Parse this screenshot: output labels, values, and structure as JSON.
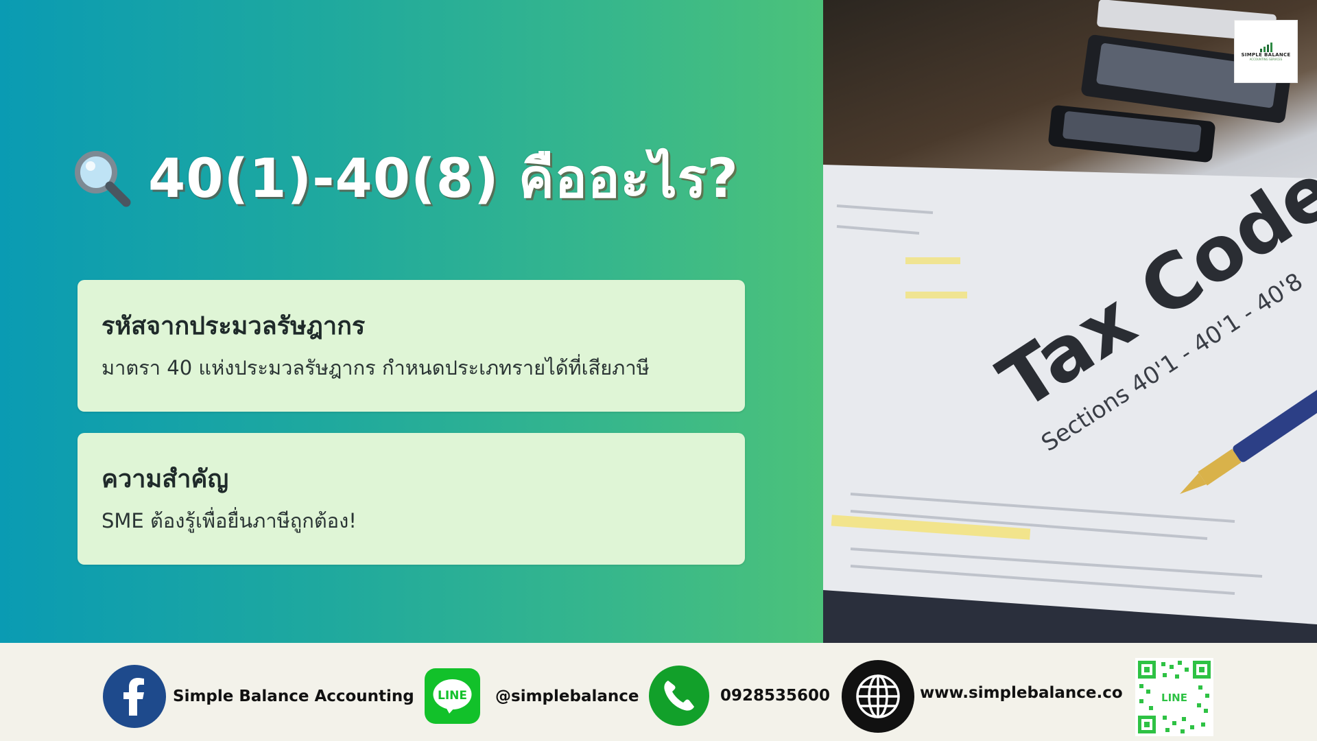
{
  "hero": {
    "title": "40(1)-40(8) คืออะไร?",
    "title_icon": "magnifier-icon",
    "background_start": "#0a9bb3",
    "background_end": "#4cc27a"
  },
  "cards": [
    {
      "heading": "รหัสจากประมวลรัษฎากร",
      "body": "มาตรา 40 แห่งประมวลรัษฎากร กำหนดประเภทรายได้ที่เสียภาษี"
    },
    {
      "heading": "ความสำคัญ",
      "body": "SME ต้องรู้เพื่อยื่นภาษีถูกต้อง!"
    }
  ],
  "photo": {
    "main_text": "Tax Code",
    "sub_text": "Sections 40'1 - 40'1 - 40'8"
  },
  "logo": {
    "text": "SIMPLE BALANCE",
    "subtext": "ACCOUNTING SERVICES"
  },
  "footer": {
    "facebook": {
      "label": "Simple Balance Accounting",
      "icon": "facebook-icon",
      "color": "#1e4a8c"
    },
    "line": {
      "label": "@simplebalance",
      "icon": "line-icon",
      "icon_text": "LINE",
      "color": "#12c12a"
    },
    "phone": {
      "label": "0928535600",
      "icon": "phone-icon",
      "color": "#12a02a"
    },
    "website": {
      "label": "www.simplebalance.co",
      "icon": "globe-icon",
      "color": "#111111"
    },
    "qr": {
      "icon": "line-qr-code",
      "label": "LINE",
      "color": "#2ec244"
    }
  }
}
